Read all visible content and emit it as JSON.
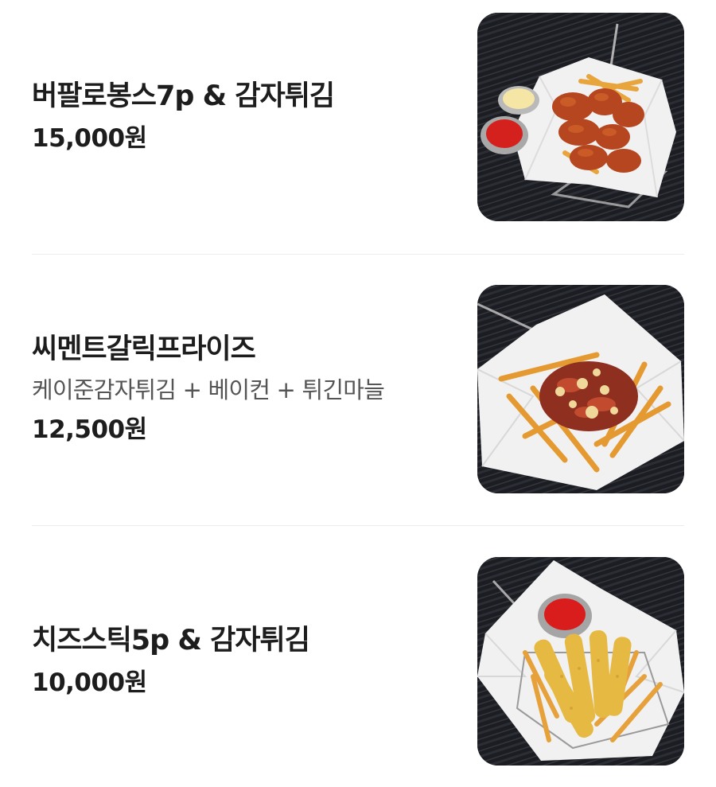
{
  "menu": {
    "items": [
      {
        "name": "버팔로봉스7p & 감자튀김",
        "description": "",
        "price": "15,000원",
        "image": "buffalo-wings-and-fries-photo"
      },
      {
        "name": "씨멘트갈릭프라이즈",
        "description": "케이준감자튀김 + 베이컨 + 튀긴마늘",
        "price": "12,500원",
        "image": "garlic-fries-photo"
      },
      {
        "name": "치즈스틱5p & 감자튀김",
        "description": "",
        "price": "10,000원",
        "image": "cheese-sticks-and-fries-photo"
      }
    ]
  }
}
